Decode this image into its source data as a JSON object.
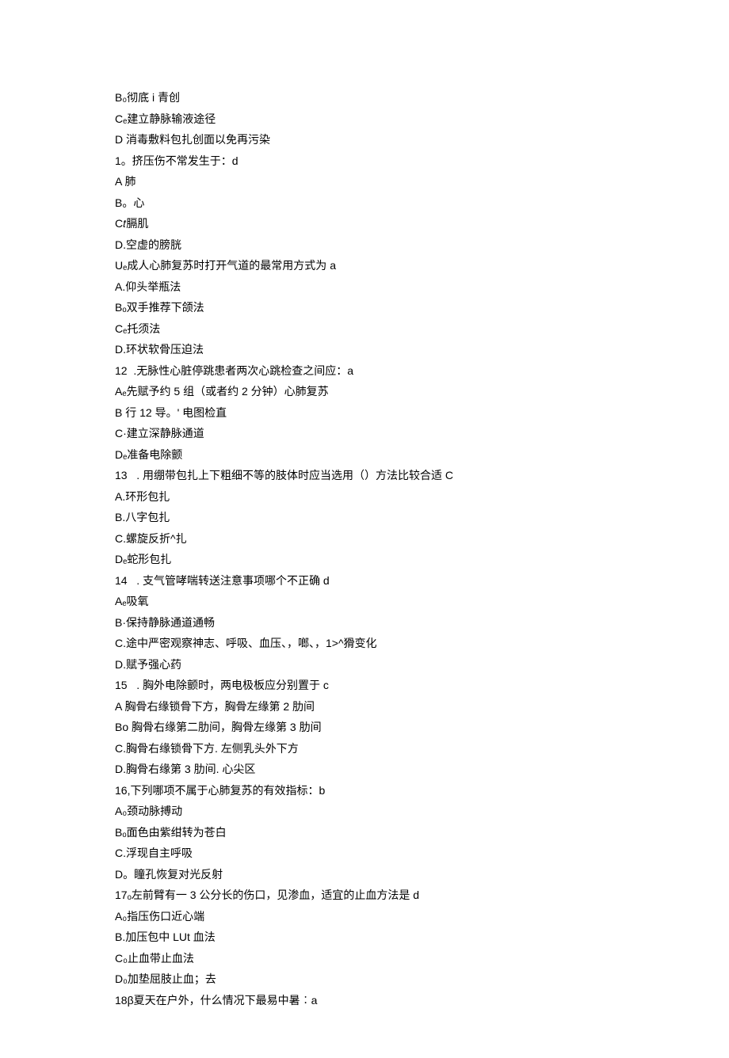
{
  "lines": [
    "B₀彻底 i 青创",
    "Cₑ建立静脉输液途径",
    "D 消毒敷料包扎创面以免再污染",
    "1。挤压伤不常发生于：d",
    "A 肺",
    "B。心",
    "C𝑡膈肌",
    "D.空虚的膀胱",
    "Uₑ成人心肺复苏时打开气道的最常用方式为 a",
    "A.仰头举瓶法",
    "Bₒ双手推荐下颌法",
    "Cₑ托须法",
    "D.环状软骨压迫法",
    "12  .无脉性心脏停跳患者两次心跳检查之间应：a",
    "Aₑ先赋予约 5 组（或者约 2 分钟）心肺复苏",
    "B 行 12 导。' 电图检直",
    "C·建立深静脉通道",
    "Dₑ准备电除颤",
    "13   . 用绷带包扎上下粗细不等的肢体时应当选用（）方法比较合适 C",
    "A.环形包扎",
    "B.八字包扎",
    "C.螺旋反折^扎",
    "Dₑ蛇形包扎",
    "14   . 支气管哮喘转送注意事项哪个不正确 d",
    "Aₑ吸氧",
    "B·保持静脉通道通畅",
    "C.途中严密观察神志、呼吸、血压、，啷、，1>^猾变化",
    "D.赋予强心药",
    "15   . 胸外电除颤时，两电极板应分别置于 c",
    "A 胸骨右缘锁骨下方，胸骨左缘第 2 肋间",
    "Bo 胸骨右缘第二肋间，胸骨左缘第 3 肋间",
    "C.胸骨右缘锁骨下方. 左侧乳头外下方",
    "D.胸骨右缘第 3 肋间. 心尖区",
    "16,下列哪项不属于心肺复苏的有效指标：b",
    "A₀颈动脉搏动",
    "Bₒ面色由紫绀转为苍白",
    "C.浮现自主呼吸",
    "D。瞳孔恢复对光反射",
    "17ₒ左前臂有一 3 公分长的伤口，见渗血，适宜的止血方法是 d",
    "A₀指压伤口近心端",
    "B.加压包中 LUt 血法",
    "C₀止血带止血法",
    "D₀加垫屈肢止血；去",
    "18β夏天在户外，什么情况下最易中暑︰a"
  ]
}
